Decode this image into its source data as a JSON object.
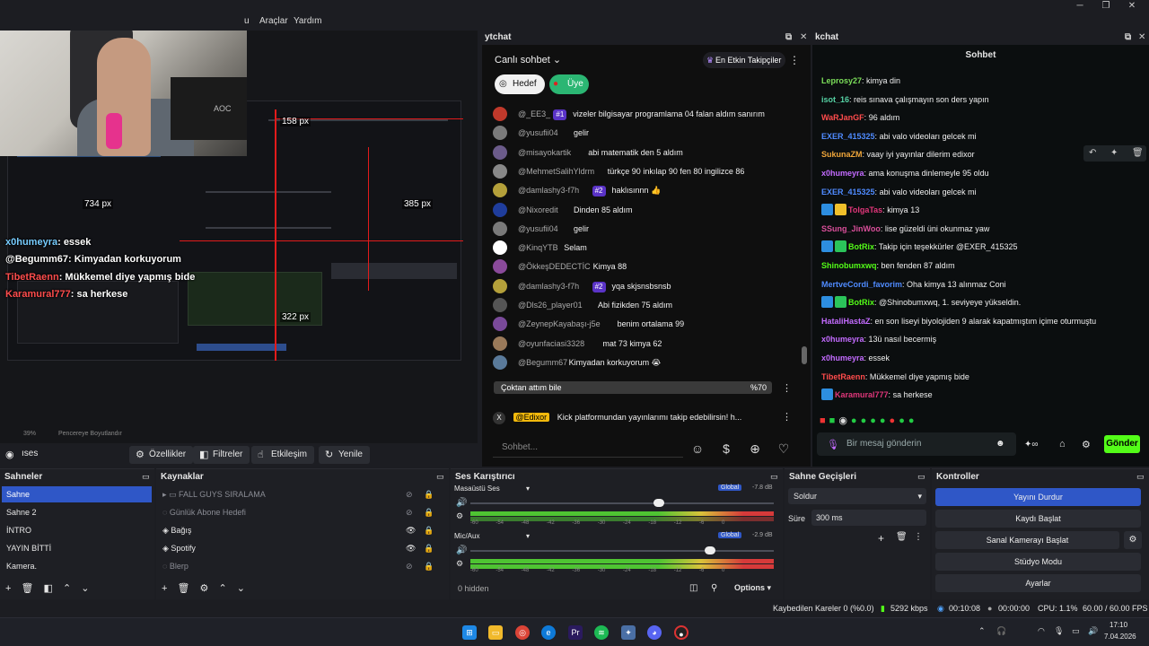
{
  "window": {
    "menu": [
      "u",
      "Araçlar",
      "Yardım"
    ],
    "min": "─",
    "max": "❐",
    "close": "✕"
  },
  "preview": {
    "overlay_chat": [
      {
        "user": "x0humeyra",
        "text": ": essek",
        "color": "#ffffff"
      },
      {
        "user": "@Begumm67",
        "text": ": Kimyadan korkuyorum",
        "color": "#ffffff"
      },
      {
        "user": "TibetRaenn",
        "text": ": Mükkemel diye yapmış bide",
        "color": "#ff4d4d"
      },
      {
        "user": "Karamural777",
        "text": ": sa herkese",
        "color": "#ff4d4d"
      }
    ],
    "px_labels": [
      "158 px",
      "734 px",
      "385 px",
      "322 px"
    ],
    "zoom": "39%",
    "fit_label": "Pencereye Boyutlandır",
    "cam_monitor_brand": "AOC"
  },
  "scene_bar": {
    "scene_label": "ıses",
    "buttons": [
      "Özellikler",
      "Filtreler",
      "Etkileşim",
      "Yenile"
    ]
  },
  "ytchat": {
    "dock_title": "ytchat",
    "header": "Canlı sohbet",
    "top_fans": "En Etkin Takipçiler",
    "pill_goal": "Hedef",
    "pill_member": "Üye",
    "messages": [
      {
        "author": "@_EE3_",
        "badge": "#1",
        "text": "vizeler bilgisayar programlama 04 falan aldım sanırım"
      },
      {
        "author": "@yusufii04",
        "badge": "",
        "text": "gelir"
      },
      {
        "author": "@misayokartik",
        "badge": "",
        "text": "abi matematik den 5 aldım"
      },
      {
        "author": "@MehmetSalihYldrm",
        "badge": "",
        "text": "türkçe 90 inkılap 90 fen 80 ingilizce 86"
      },
      {
        "author": "@damlashy3-f7h",
        "badge": "#2",
        "text": "haklısınnn 👍"
      },
      {
        "author": "@Nixoredit",
        "badge": "",
        "text": "Dinden 85 aldım"
      },
      {
        "author": "@yusufii04",
        "badge": "",
        "text": "gelir"
      },
      {
        "author": "@KinqYTB",
        "badge": "",
        "text": "Selam"
      },
      {
        "author": "@ÖkkeşDEDECTİC",
        "badge": "",
        "text": "Kimya 88"
      },
      {
        "author": "@damlashy3-f7h",
        "badge": "#2",
        "text": "yqa skjsnsbsnsb"
      },
      {
        "author": "@Dls26_player01",
        "badge": "",
        "text": "Abi fizikden 75 aldım"
      },
      {
        "author": "@ZeynepKayabaşı-j5e",
        "badge": "",
        "text": "benim ortalama 99"
      },
      {
        "author": "@oyunfaciasi3328",
        "badge": "",
        "text": "mat 73 kimya 62"
      },
      {
        "author": "@Begumm67",
        "badge": "",
        "text": "Kimyadan korkuyorum 😭"
      }
    ],
    "poll": {
      "label": "Çoktan attım bile",
      "percent": "%70"
    },
    "pinned": {
      "author": "@Edixor",
      "text": "Kick platformundan yayınlarımı takip edebilirsin! h..."
    },
    "input_placeholder": "Sohbet..."
  },
  "kickchat": {
    "dock_title": "kchat",
    "title": "Sohbet",
    "messages": [
      {
        "user": "Leprosy27",
        "color": "#7cdf5a",
        "text": "kimya din",
        "badges": []
      },
      {
        "user": "isot_16",
        "color": "#56d3a5",
        "text": "reis sınava çalışmayın son ders yapın",
        "badges": []
      },
      {
        "user": "WaRJanGF",
        "color": "#ff4c4c",
        "text": "96 aldım",
        "badges": []
      },
      {
        "user": "EXER_415325",
        "color": "#4f8bff",
        "text": "abi valo videoları gelcek mi",
        "badges": []
      },
      {
        "user": "SukunaZM",
        "color": "#f0a63a",
        "text": "vaay iyi yayınlar dilerim edixor",
        "badges": []
      },
      {
        "user": "x0humeyra",
        "color": "#c36bff",
        "text": "ama konuşma dinlemeyle 95 oldu",
        "badges": []
      },
      {
        "user": "EXER_415325",
        "color": "#4f8bff",
        "text": "abi valo videoları gelcek mi",
        "badges": []
      },
      {
        "user": "TolgaTas",
        "color": "#e0367a",
        "text": "kimya 13",
        "badges": [
          "#2d8ee0",
          "#f0c02a"
        ]
      },
      {
        "user": "SSung_JinWoo",
        "color": "#d94f9a",
        "text": "lise güzeldi üni okunmaz yaw",
        "badges": []
      },
      {
        "user": "BotRix",
        "color": "#53fc18",
        "text": "Takip için teşekkürler @EXER_415325",
        "badges": [
          "#2d8ee0",
          "#2bc45a"
        ]
      },
      {
        "user": "Shinobumxwq",
        "color": "#53fc18",
        "text": "ben fenden 87 aldım",
        "badges": []
      },
      {
        "user": "MertveCordi_favorim",
        "color": "#4f8bff",
        "text": "Oha kimya 13 alınmaz Coni",
        "badges": []
      },
      {
        "user": "BotRix",
        "color": "#53fc18",
        "text": "@Shinobumxwq, 1. seviyeye yükseldin.",
        "badges": [
          "#2d8ee0",
          "#2bc45a"
        ]
      },
      {
        "user": "HataliHastaZ",
        "color": "#c36bff",
        "text": "en son liseyi biyolojiden 9 alarak kapatmıştım içime oturmuştu",
        "badges": []
      },
      {
        "user": "x0humeyra",
        "color": "#c36bff",
        "text": "13ü nasıl becermiş",
        "badges": []
      },
      {
        "user": "x0humeyra",
        "color": "#c36bff",
        "text": "essek",
        "badges": []
      },
      {
        "user": "TibetRaenn",
        "color": "#ff4c4c",
        "text": "Mükkemel diye yapmış bide",
        "badges": []
      },
      {
        "user": "Karamural777",
        "color": "#e0367a",
        "text": "sa herkese",
        "badges": [
          "#2d8ee0"
        ]
      }
    ],
    "input_placeholder": "Bir mesaj gönderin",
    "send": "Gönder"
  },
  "scenes": {
    "title": "Sahneler",
    "items": [
      "Sahne",
      "Sahne 2",
      "İNTRO",
      "YAYIN BİTTİ",
      "Kamera."
    ],
    "selected": 0
  },
  "sources": {
    "title": "Kaynaklar",
    "items": [
      {
        "name": "FALL GUYS SIRALAMA",
        "visible": false,
        "folder": true
      },
      {
        "name": "Günlük Abone Hedefi",
        "visible": false,
        "folder": false
      },
      {
        "name": "Bağış",
        "visible": true,
        "folder": false
      },
      {
        "name": "Spotify",
        "visible": true,
        "folder": false
      },
      {
        "name": "Blerp",
        "visible": false,
        "folder": false
      }
    ]
  },
  "mixer": {
    "title": "Ses Karıştırıcı",
    "channels": [
      {
        "name": "Masaüstü Ses",
        "tag": "Global",
        "db": "-7.8 dB",
        "level": 0.62
      },
      {
        "name": "Mic/Aux",
        "tag": "Global",
        "db": "-2.9 dB",
        "level": 0.79
      }
    ],
    "scale": "-60 -54 -48 -42 -36 -30 -24 -18 -12 -6 0",
    "hidden": "0 hidden",
    "options": "Options"
  },
  "transitions": {
    "title": "Sahne Geçişleri",
    "type": "Soldur",
    "duration_label": "Süre",
    "duration": "300 ms"
  },
  "controls": {
    "title": "Kontroller",
    "buttons": [
      "Yayını Durdur",
      "Kaydı Başlat",
      "Sanal Kamerayı Başlat",
      "Stüdyo Modu",
      "Ayarlar"
    ]
  },
  "status": {
    "dropped": "Kaybedilen Kareler 0 (%0.0)",
    "bitrate": "5292 kbps",
    "time": "00:10:08",
    "rec": "00:00:00",
    "cpu": "CPU: 1.1%",
    "fps": "60.00 / 60.00 FPS"
  },
  "taskbar": {
    "time": "17:10",
    "date": "7.04.2026"
  }
}
